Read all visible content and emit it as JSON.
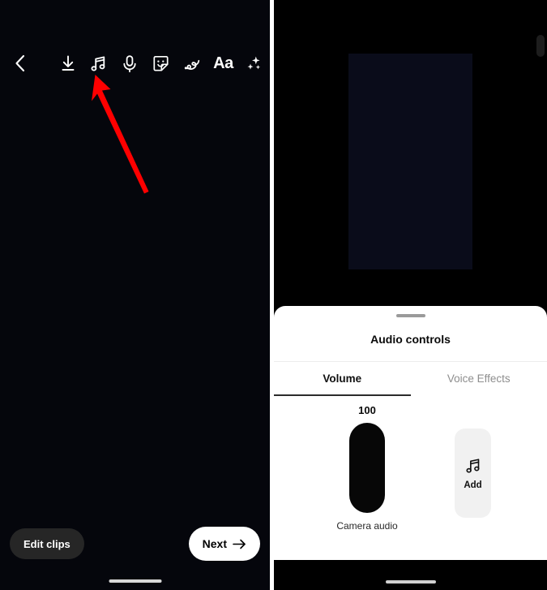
{
  "left_screen": {
    "toolbar": {
      "items": [
        {
          "name": "back-icon",
          "label": "Back"
        },
        {
          "name": "download-icon",
          "label": "Save"
        },
        {
          "name": "music-note-icon",
          "label": "Audio"
        },
        {
          "name": "microphone-icon",
          "label": "Voiceover"
        },
        {
          "name": "sticker-icon",
          "label": "Stickers"
        },
        {
          "name": "draw-icon",
          "label": "Draw"
        },
        {
          "name": "text-icon",
          "label": "Aa"
        },
        {
          "name": "effects-icon",
          "label": "Effects"
        }
      ],
      "text_tool_label": "Aa"
    },
    "annotation": {
      "type": "arrow",
      "color": "#ff0000",
      "points_to": "music-note-icon"
    },
    "bottom_bar": {
      "edit_clips_label": "Edit clips",
      "next_label": "Next",
      "next_icon": "arrow-right-icon"
    }
  },
  "right_screen": {
    "sheet": {
      "title": "Audio controls",
      "tabs": [
        {
          "label": "Volume",
          "active": true
        },
        {
          "label": "Voice Effects",
          "active": false
        }
      ],
      "volume_panel": {
        "track_value": "100",
        "track_label": "Camera audio",
        "add_tile": {
          "icon": "music-note-icon",
          "label": "Add"
        }
      }
    }
  },
  "colors": {
    "accent_red": "#ff0000",
    "sheet_bg": "#ffffff",
    "tab_active": "#101010",
    "tab_inactive": "#8e8e8e",
    "slider_fill": "#070707",
    "add_tile_bg": "#f1f1f1",
    "screen_bg": "#05060c"
  }
}
